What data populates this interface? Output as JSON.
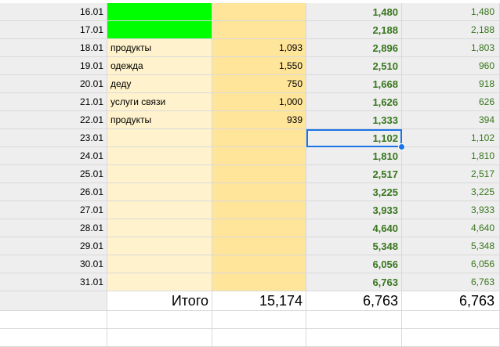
{
  "colors": {
    "date_bg": "#eeeeee",
    "desc_bg": "#fff2cc",
    "amount_bg": "#ffe599",
    "balance_text": "#38761d",
    "highlight_green": "#00ff00",
    "selection_blue": "#1a73e8"
  },
  "rows": [
    {
      "date": "16.01",
      "desc": "",
      "amount": "",
      "balance": "1,480",
      "aux": "1,480",
      "green": true
    },
    {
      "date": "17.01",
      "desc": "",
      "amount": "",
      "balance": "2,188",
      "aux": "2,188",
      "green": true
    },
    {
      "date": "18.01",
      "desc": "продукты",
      "amount": "1,093",
      "balance": "2,896",
      "aux": "1,803"
    },
    {
      "date": "19.01",
      "desc": "одежда",
      "amount": "1,550",
      "balance": "2,510",
      "aux": "960"
    },
    {
      "date": "20.01",
      "desc": "деду",
      "amount": "750",
      "balance": "1,668",
      "aux": "918"
    },
    {
      "date": "21.01",
      "desc": "услуги связи",
      "amount": "1,000",
      "balance": "1,626",
      "aux": "626"
    },
    {
      "date": "22.01",
      "desc": "продукты",
      "amount": "939",
      "balance": "1,333",
      "aux": "394"
    },
    {
      "date": "23.01",
      "desc": "",
      "amount": "",
      "balance": "1,102",
      "aux": "1,102",
      "selected": true
    },
    {
      "date": "24.01",
      "desc": "",
      "amount": "",
      "balance": "1,810",
      "aux": "1,810"
    },
    {
      "date": "25.01",
      "desc": "",
      "amount": "",
      "balance": "2,517",
      "aux": "2,517"
    },
    {
      "date": "26.01",
      "desc": "",
      "amount": "",
      "balance": "3,225",
      "aux": "3,225"
    },
    {
      "date": "27.01",
      "desc": "",
      "amount": "",
      "balance": "3,933",
      "aux": "3,933"
    },
    {
      "date": "28.01",
      "desc": "",
      "amount": "",
      "balance": "4,640",
      "aux": "4,640"
    },
    {
      "date": "29.01",
      "desc": "",
      "amount": "",
      "balance": "5,348",
      "aux": "5,348"
    },
    {
      "date": "30.01",
      "desc": "",
      "amount": "",
      "balance": "6,056",
      "aux": "6,056"
    },
    {
      "date": "31.01",
      "desc": "",
      "amount": "",
      "balance": "6,763",
      "aux": "6,763"
    }
  ],
  "totals": {
    "label": "Итого",
    "amount": "15,174",
    "balance": "6,763",
    "aux": "6,763"
  }
}
